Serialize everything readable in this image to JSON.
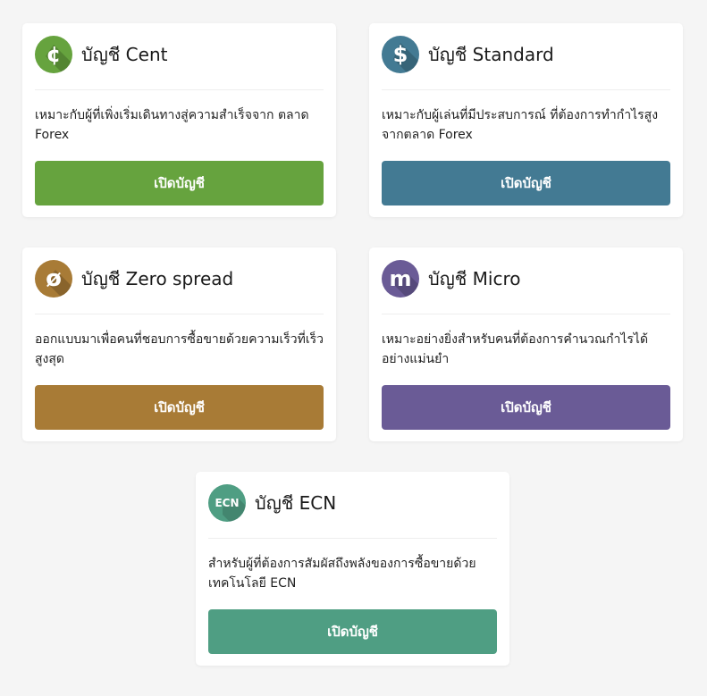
{
  "accounts": [
    {
      "icon": "cent-icon",
      "glyph": "¢",
      "title": "บัญชี Cent",
      "description": "เหมาะกับผู้ที่เพิ่งเริ่มเดินทางสู่ความสำเร็จจาก ตลาด Forex",
      "button_label": "เปิดบัญชี",
      "color": "#66a33e"
    },
    {
      "icon": "dollar-icon",
      "glyph": "$",
      "title": "บัญชี Standard",
      "description": "เหมาะกับผู้เล่นที่มีประสบการณ์ ที่ต้องการทำกำไรสูงจากตลาด Forex",
      "button_label": "เปิดบัญชี",
      "color": "#437a93"
    },
    {
      "icon": "zero-spread-icon",
      "glyph": "ø",
      "title": "บัญชี Zero spread",
      "description": "ออกแบบมาเพื่อคนที่ชอบการซื้อขายด้วยความเร็วที่เร็วสูงสุด",
      "button_label": "เปิดบัญชี",
      "color": "#a87b36"
    },
    {
      "icon": "micro-icon",
      "glyph": "m",
      "title": "บัญชี Micro",
      "description": "เหมาะอย่างยิ่งสำหรับคนที่ต้องการคำนวณกำไรได้อย่างแม่นยำ",
      "button_label": "เปิดบัญชี",
      "color": "#6a5b96"
    },
    {
      "icon": "ecn-icon",
      "glyph": "ECN",
      "title": "บัญชี ECN",
      "description": "สำหรับผู้ที่ต้องการสัมผัสถึงพลังของการซื้อขายด้วยเทคโนโลยี ECN",
      "button_label": "เปิดบัญชี",
      "color": "#4f9e83"
    }
  ]
}
